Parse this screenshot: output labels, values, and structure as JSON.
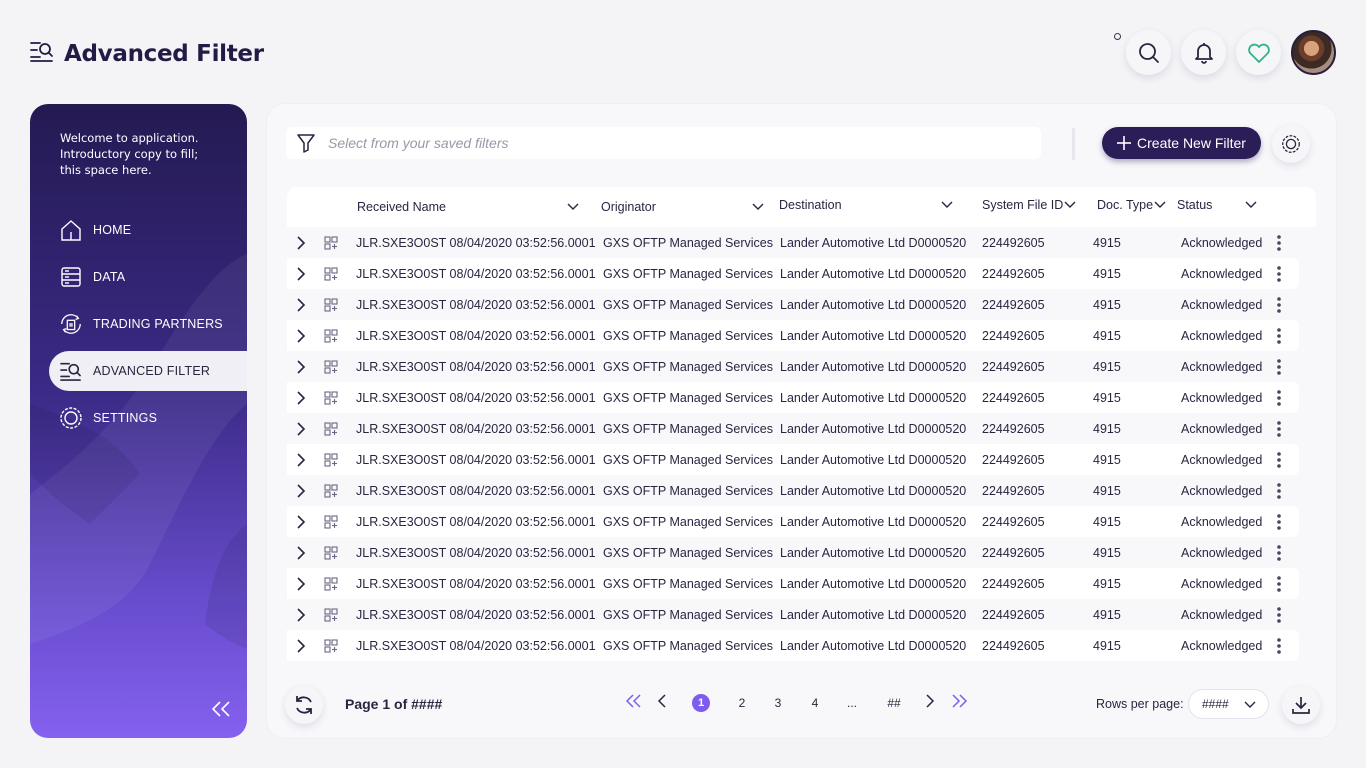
{
  "header": {
    "title": "Advanced Filter"
  },
  "sidebar": {
    "welcome": "Welcome to  application. Introductory copy to fill; this space here.",
    "items": [
      {
        "label": "HOME",
        "icon": "home-icon"
      },
      {
        "label": "DATA",
        "icon": "data-icon"
      },
      {
        "label": "TRADING PARTNERS",
        "icon": "trading-partners-icon"
      },
      {
        "label": "ADVANCED FILTER",
        "icon": "advanced-filter-icon",
        "active": true
      },
      {
        "label": "SETTINGS",
        "icon": "settings-icon"
      }
    ]
  },
  "toolbar": {
    "filter_placeholder": "Select from your saved filters",
    "create_label": "Create New Filter"
  },
  "table": {
    "columns": [
      "Received Name",
      "Originator",
      "Destination",
      "System File ID",
      "Doc. Type",
      "Status"
    ],
    "rows": [
      [
        "JLR.SXE3O0ST 08/04/2020 03:52:56.0001",
        "GXS OFTP Managed Services",
        "Lander Automotive Ltd D0000520",
        "224492605",
        "4915",
        "Acknowledged"
      ],
      [
        "JLR.SXE3O0ST 08/04/2020 03:52:56.0001",
        "GXS OFTP Managed Services",
        "Lander Automotive Ltd D0000520",
        "224492605",
        "4915",
        "Acknowledged"
      ],
      [
        "JLR.SXE3O0ST 08/04/2020 03:52:56.0001",
        "GXS OFTP Managed Services",
        "Lander Automotive Ltd D0000520",
        "224492605",
        "4915",
        "Acknowledged"
      ],
      [
        "JLR.SXE3O0ST 08/04/2020 03:52:56.0001",
        "GXS OFTP Managed Services",
        "Lander Automotive Ltd D0000520",
        "224492605",
        "4915",
        "Acknowledged"
      ],
      [
        "JLR.SXE3O0ST 08/04/2020 03:52:56.0001",
        "GXS OFTP Managed Services",
        "Lander Automotive Ltd D0000520",
        "224492605",
        "4915",
        "Acknowledged"
      ],
      [
        "JLR.SXE3O0ST 08/04/2020 03:52:56.0001",
        "GXS OFTP Managed Services",
        "Lander Automotive Ltd D0000520",
        "224492605",
        "4915",
        "Acknowledged"
      ],
      [
        "JLR.SXE3O0ST 08/04/2020 03:52:56.0001",
        "GXS OFTP Managed Services",
        "Lander Automotive Ltd D0000520",
        "224492605",
        "4915",
        "Acknowledged"
      ],
      [
        "JLR.SXE3O0ST 08/04/2020 03:52:56.0001",
        "GXS OFTP Managed Services",
        "Lander Automotive Ltd D0000520",
        "224492605",
        "4915",
        "Acknowledged"
      ],
      [
        "JLR.SXE3O0ST 08/04/2020 03:52:56.0001",
        "GXS OFTP Managed Services",
        "Lander Automotive Ltd D0000520",
        "224492605",
        "4915",
        "Acknowledged"
      ],
      [
        "JLR.SXE3O0ST 08/04/2020 03:52:56.0001",
        "GXS OFTP Managed Services",
        "Lander Automotive Ltd D0000520",
        "224492605",
        "4915",
        "Acknowledged"
      ],
      [
        "JLR.SXE3O0ST 08/04/2020 03:52:56.0001",
        "GXS OFTP Managed Services",
        "Lander Automotive Ltd D0000520",
        "224492605",
        "4915",
        "Acknowledged"
      ],
      [
        "JLR.SXE3O0ST 08/04/2020 03:52:56.0001",
        "GXS OFTP Managed Services",
        "Lander Automotive Ltd D0000520",
        "224492605",
        "4915",
        "Acknowledged"
      ],
      [
        "JLR.SXE3O0ST 08/04/2020 03:52:56.0001",
        "GXS OFTP Managed Services",
        "Lander Automotive Ltd D0000520",
        "224492605",
        "4915",
        "Acknowledged"
      ],
      [
        "JLR.SXE3O0ST 08/04/2020 03:52:56.0001",
        "GXS OFTP Managed Services",
        "Lander Automotive Ltd D0000520",
        "224492605",
        "4915",
        "Acknowledged"
      ]
    ]
  },
  "pagination": {
    "page_label": "Page 1 of ####",
    "pages": [
      "1",
      "2",
      "3",
      "4",
      "...",
      "##"
    ],
    "current": "1",
    "rows_per_page_label": "Rows per page:",
    "rows_per_page_value": "####"
  },
  "colors": {
    "accent": "#7c5df0",
    "primary": "#2a1d58",
    "heart": "#2fb38a"
  }
}
